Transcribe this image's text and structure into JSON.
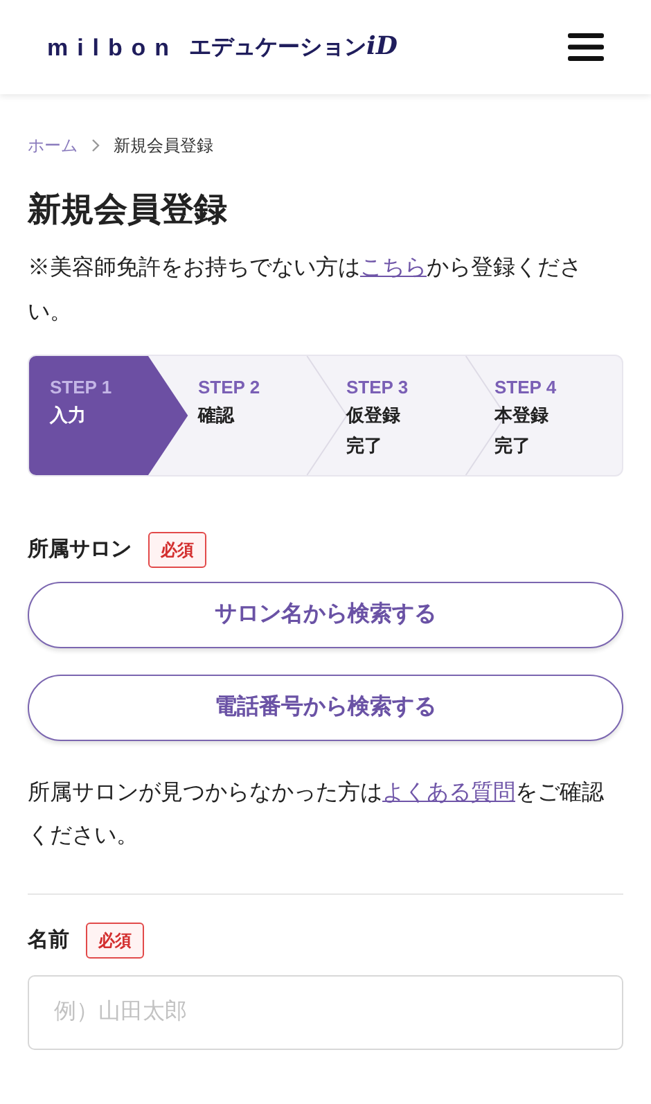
{
  "header": {
    "logo_wordmark": "milbon",
    "logo_suffix": "エデュケーション",
    "logo_id": "iD"
  },
  "breadcrumb": [
    {
      "label": "ホーム",
      "link": true
    },
    {
      "label": "新規会員登録",
      "link": false
    }
  ],
  "title": "新規会員登録",
  "note": {
    "before": "※美容師免許をお持ちでない方は",
    "link": "こちら",
    "after": "から登録ください。"
  },
  "steps": [
    {
      "label": "STEP 1",
      "name": "入力",
      "selected": true
    },
    {
      "label": "STEP 2",
      "name": "確認",
      "selected": false
    },
    {
      "label": "STEP 3",
      "name": "仮登録完了",
      "selected": false
    },
    {
      "label": "STEP 4",
      "name": "本登録完了",
      "selected": false
    }
  ],
  "salon": {
    "label": "所属サロン",
    "required": "必須",
    "buttons": [
      "サロン名から検索する",
      "電話番号から検索する"
    ],
    "help": {
      "before": "所属サロンが見つからなかった方は",
      "link": "よくある質問",
      "after": "をご確認ください。"
    }
  },
  "name_field": {
    "label": "名前",
    "required": "必須",
    "placeholder": "例）山田太郎"
  }
}
